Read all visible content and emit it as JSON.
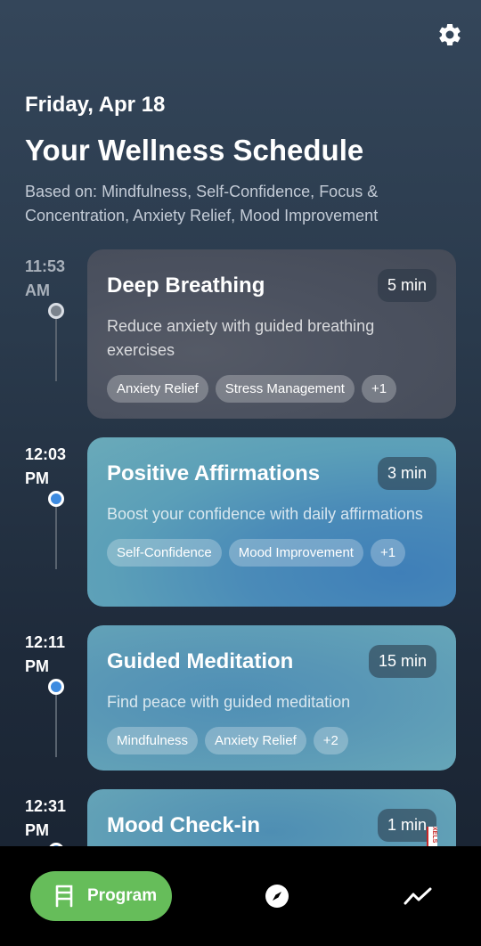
{
  "header": {
    "date": "Friday, Apr 18",
    "title": "Your Wellness Schedule",
    "based_on": "Based on: Mindfulness, Self-Confidence, Focus & Concentration, Anxiety Relief, Mood Improvement"
  },
  "schedule": [
    {
      "time": "11:53",
      "ampm": "AM",
      "title": "Deep Breathing",
      "duration": "5 min",
      "description": "Reduce anxiety with guided breathing exercises",
      "tags": [
        "Anxiety Relief",
        "Stress Management",
        "+1"
      ]
    },
    {
      "time": "12:03",
      "ampm": "PM",
      "title": "Positive Affirmations",
      "duration": "3 min",
      "description": "Boost your confidence with daily affirmations",
      "tags": [
        "Self-Confidence",
        "Mood Improvement",
        "+1"
      ]
    },
    {
      "time": "12:11",
      "ampm": "PM",
      "title": "Guided Meditation",
      "duration": "15 min",
      "description": "Find peace with guided meditation",
      "tags": [
        "Mindfulness",
        "Anxiety Relief",
        "+2"
      ]
    },
    {
      "time": "12:31",
      "ampm": "PM",
      "title": "Mood Check-in",
      "duration": "1 min"
    }
  ],
  "ad_label": "XELS",
  "nav": {
    "program_label": "Program",
    "icons": [
      "program-icon",
      "compass-icon",
      "trending-icon"
    ]
  },
  "colors": {
    "accent_green": "#66bd5a",
    "active_dot": "#3d8be0"
  }
}
